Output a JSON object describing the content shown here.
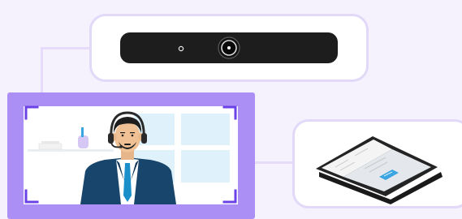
{
  "colors": {
    "background": "#f5f1fd",
    "accent_purple": "#ab8ff5",
    "corner_purple": "#6b42e8",
    "card_border": "#e2d9f8",
    "camera_bar": "#1d1d1d",
    "suit_navy": "#17456c",
    "tie_teal": "#1a8fc9",
    "window_blue": "#dff2fc",
    "tablet_dark": "#242424",
    "tablet_button": "#3aa5e0"
  },
  "icons": {
    "camera": "conference-camera-bar-icon",
    "agent": "headset-agent-icon",
    "tablet": "touch-controller-tablet-icon"
  }
}
